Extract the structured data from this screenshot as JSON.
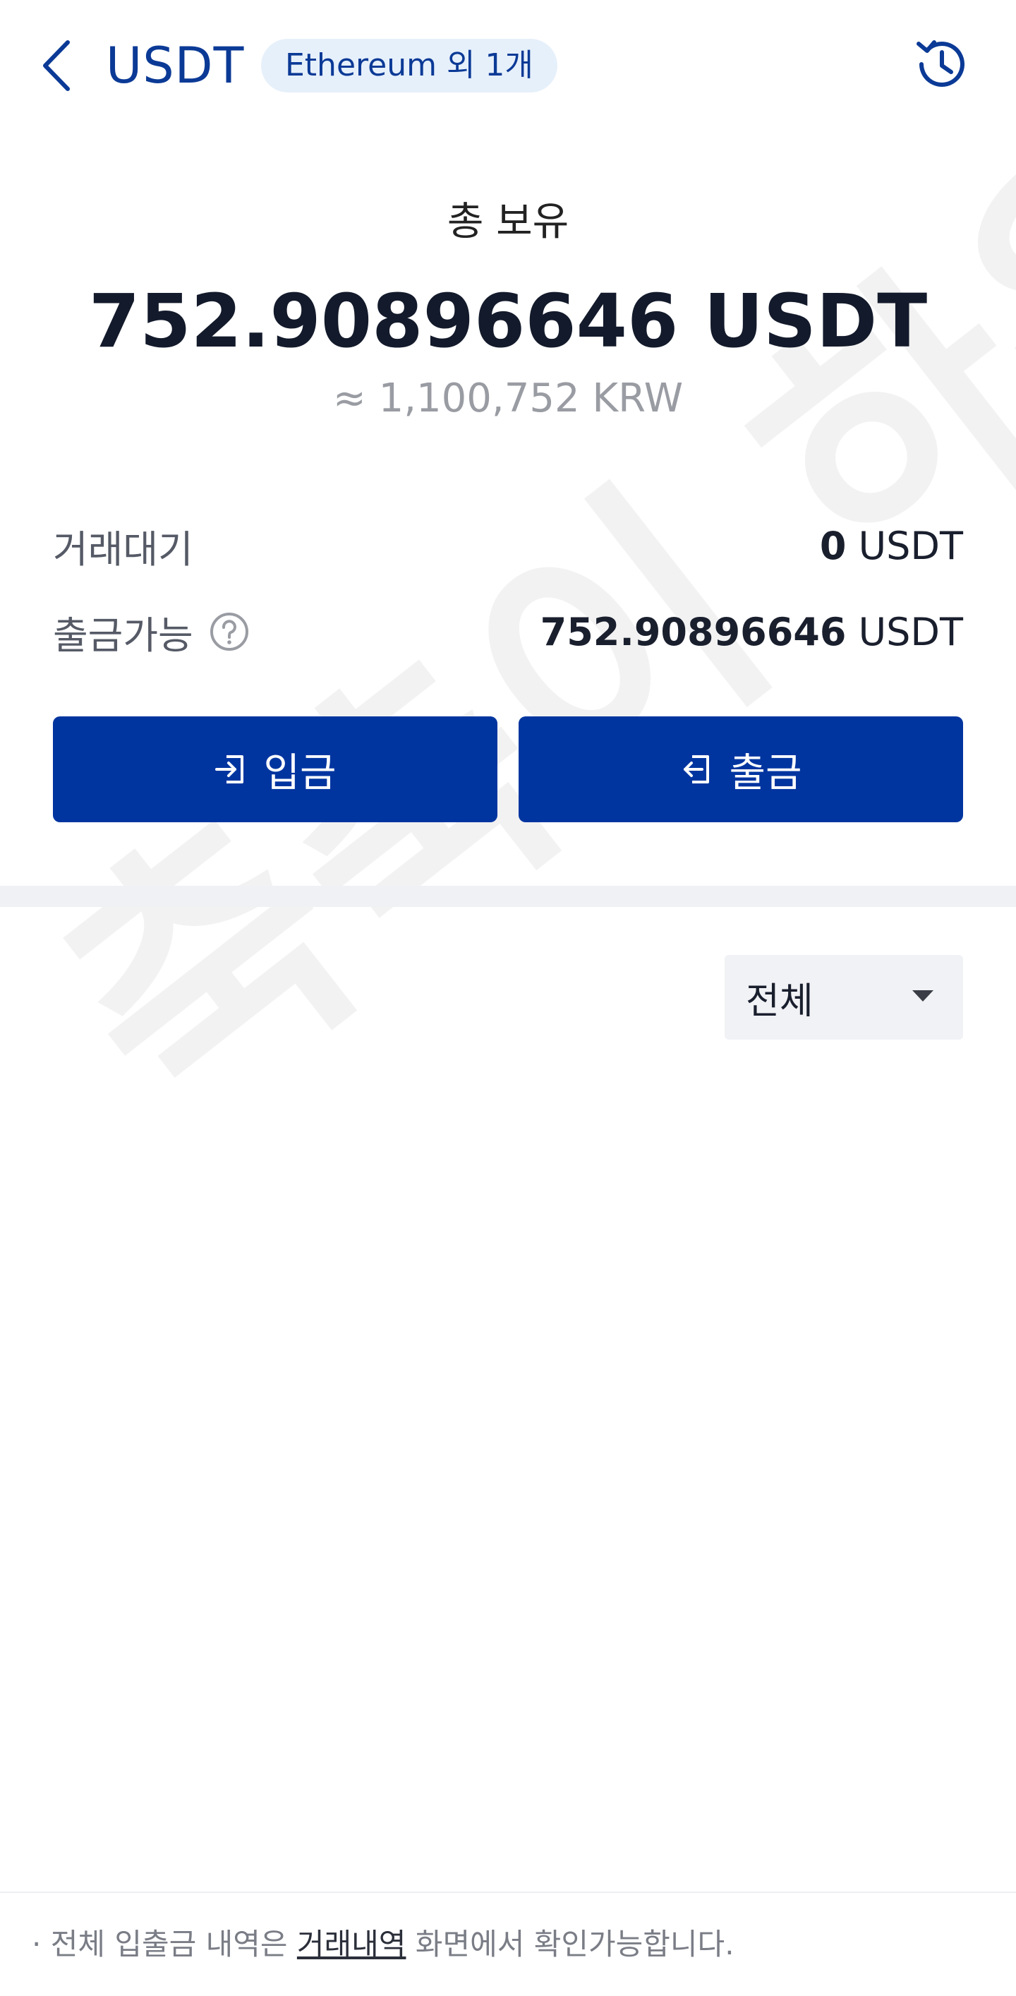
{
  "header": {
    "title": "USDT",
    "network_chip": "Ethereum 외 1개",
    "back_icon": "chevron-left-icon",
    "history_icon": "history-clock-icon"
  },
  "summary": {
    "total_label": "총 보유",
    "total_amount": "752.90896646 USDT",
    "krw_amount": "≈ 1,100,752 KRW"
  },
  "balances": {
    "pending": {
      "label": "거래대기",
      "value": "0",
      "unit": "USDT"
    },
    "withdrawable": {
      "label": "출금가능",
      "value": "752.90896646",
      "unit": "USDT",
      "help_icon": "question-circle-icon"
    }
  },
  "actions": {
    "deposit": {
      "label": "입금",
      "icon": "deposit-arrow-icon"
    },
    "withdraw": {
      "label": "출금",
      "icon": "withdraw-arrow-icon"
    }
  },
  "filter": {
    "selected": "전체",
    "icon": "caret-down-icon"
  },
  "watermark": "축축이 하우스",
  "footer": {
    "bullet": "·",
    "prefix": " 전체 입출금 내역은 ",
    "link": "거래내역",
    "suffix": " 화면에서 확인가능합니다."
  },
  "colors": {
    "primary": "#0035a0",
    "brand_text": "#0b3a96",
    "chip_bg": "#e6f0fb",
    "muted": "#9a9ca3"
  }
}
